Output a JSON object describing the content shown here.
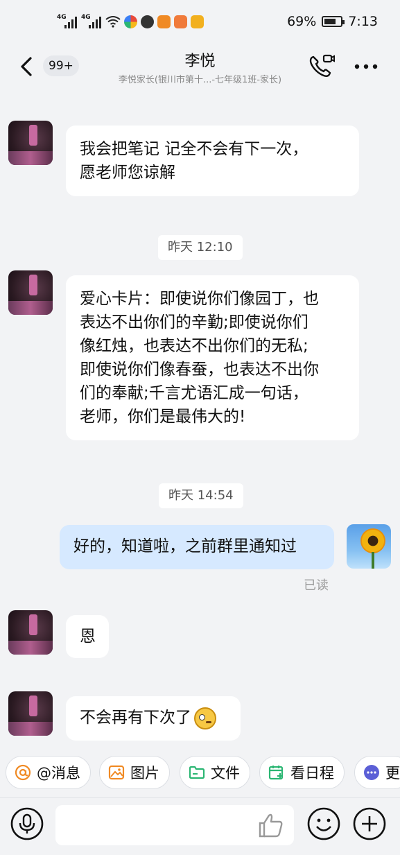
{
  "status_bar": {
    "signal1_tag": "4G",
    "signal2_tag": "4G",
    "battery_text": "69%",
    "battery_level": 0.69,
    "time": "7:13",
    "app_icons": [
      "wifi-icon",
      "colorful-pinwheel-icon",
      "globe-icon",
      "orange-video-icon",
      "orange-heart-icon",
      "yellow-chat-icon"
    ]
  },
  "header": {
    "unread_badge": "99+",
    "title": "李悦",
    "subtitle": "李悦家长(银川市第十...-七年级1班-家长)"
  },
  "messages": {
    "m1": {
      "line1": "我会把笔记 记全不会有下一次，",
      "line2": "愿老师您谅解"
    },
    "time1": "昨天 12:10",
    "m2": {
      "line1": "爱心卡片：即使说你们像园丁，也",
      "line2": "表达不出你们的辛勤;即使说你们",
      "line3": "像红烛，也表达不出你们的无私;",
      "line4": "即使说你们像春蚕，也表达不出你",
      "line5": "们的奉献;千言尤语汇成一句话，",
      "line6": "老师，你们是最伟大的!"
    },
    "time2": "昨天 14:54",
    "m3": "好的，知道啦，之前群里通知过",
    "read_status": "已读",
    "m4": "恩",
    "m5": "不会再有下次了"
  },
  "chips": {
    "mention": "@消息",
    "image": "图片",
    "file": "文件",
    "schedule": "看日程",
    "more": "更"
  },
  "colors": {
    "accent_blue": "#3b7ff5",
    "my_bubble": "#d6e9ff",
    "chip_orange": "#f08a24",
    "chip_green": "#2bb673",
    "chip_purple": "#5b5fd6"
  }
}
